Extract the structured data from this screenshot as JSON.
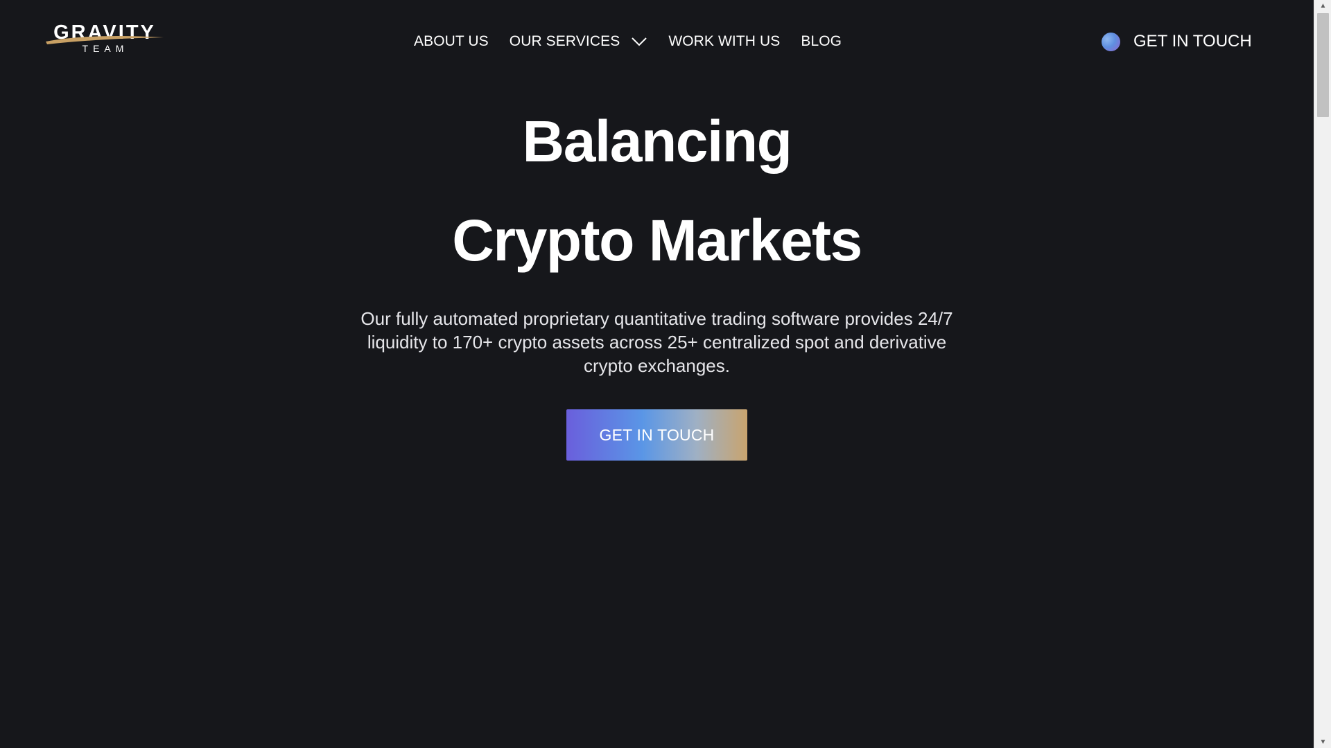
{
  "header": {
    "logo": {
      "word": "GRAVITY",
      "sub": "TEAM"
    },
    "nav": [
      {
        "label": "ABOUT US"
      },
      {
        "label": "OUR SERVICES",
        "has_dropdown": true
      },
      {
        "label": "WORK WITH US"
      },
      {
        "label": "BLOG"
      }
    ],
    "cta_label": "GET IN TOUCH"
  },
  "hero": {
    "title_line1": "Balancing",
    "title_line2": "Crypto Markets",
    "description": "Our fully automated proprietary quantitative trading software provides 24/7 liquidity to 170+ crypto assets across 25+ centralized spot and derivative crypto exchanges.",
    "cta_label": "GET IN TOUCH"
  },
  "scrollbar": {
    "up_icon": "triangle-up",
    "down_icon": "triangle-down"
  },
  "colors": {
    "background": "#16171b",
    "text": "#ffffff",
    "cta_gradient": [
      "#6a5fdc",
      "#5a96e6",
      "#9fb0c4",
      "#c9a46e"
    ],
    "logo_swoosh": "#c8a064"
  }
}
